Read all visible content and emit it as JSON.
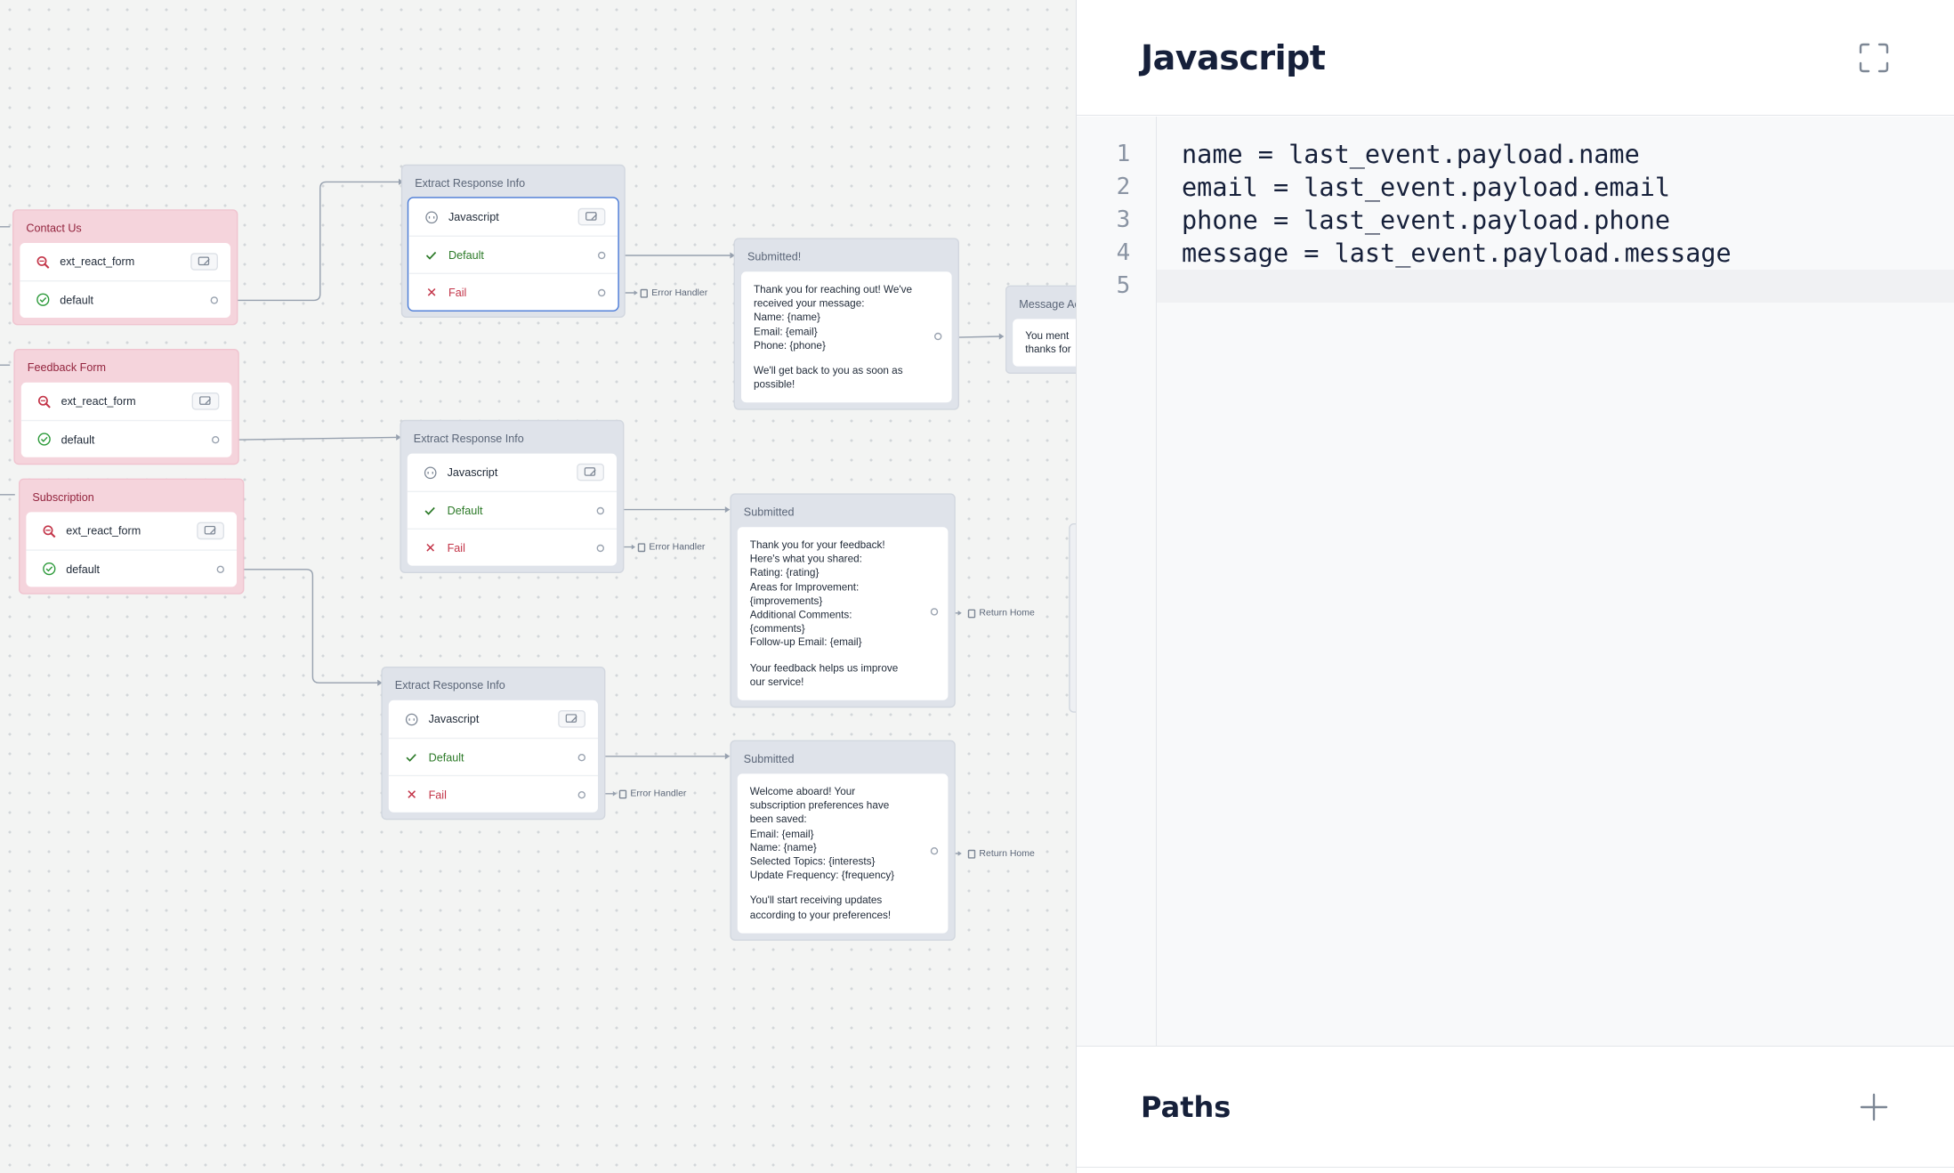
{
  "canvas": {
    "flows": [
      {
        "trigger_title": "Contact Us",
        "trigger_source": "ext_react_form",
        "trigger_default": "default",
        "extract_title": "Extract Response Info",
        "step_label": "Javascript",
        "default_label": "Default",
        "fail_label": "Fail",
        "error_tag": "Error Handler",
        "submitted_title": "Submitted!",
        "message_paragraphs": [
          "Thank you for reaching out! We've\nreceived your message:\nName: {name}\nEmail: {email}\nPhone: {phone}",
          "We'll get back to you as soon as\npossible!"
        ]
      },
      {
        "trigger_title": "Feedback Form",
        "trigger_source": "ext_react_form",
        "trigger_default": "default",
        "extract_title": "Extract Response Info",
        "step_label": "Javascript",
        "default_label": "Default",
        "fail_label": "Fail",
        "error_tag": "Error Handler",
        "submitted_title": "Submitted",
        "message_paragraphs": [
          "Thank you for your feedback!\nHere's what you shared:\nRating: {rating}\nAreas for Improvement:\n{improvements}\nAdditional Comments:\n{comments}\nFollow-up Email: {email}",
          "Your feedback helps us improve\nour service!"
        ],
        "next_tag": "Return Home"
      },
      {
        "trigger_title": "Subscription",
        "trigger_source": "ext_react_form",
        "trigger_default": "default",
        "extract_title": "Extract Response Info",
        "step_label": "Javascript",
        "default_label": "Default",
        "fail_label": "Fail",
        "error_tag": "Error Handler",
        "submitted_title": "Submitted",
        "message_paragraphs": [
          "Welcome aboard! Your\nsubscription preferences have\nbeen saved:\nEmail: {email}\nName: {name}\nSelected Topics: {interests}\nUpdate Frequency: {frequency}",
          "You'll start receiving updates\naccording to your preferences!"
        ],
        "next_tag": "Return Home"
      }
    ],
    "partial_block": {
      "title": "Message Ac",
      "text": "You ment\nthanks for"
    }
  },
  "panel": {
    "title": "Javascript",
    "code_lines": [
      "name = last_event.payload.name",
      "email = last_event.payload.email",
      "phone = last_event.payload.phone",
      "message = last_event.payload.message",
      ""
    ],
    "line_numbers": [
      "1",
      "2",
      "3",
      "4",
      "5"
    ],
    "paths_title": "Paths"
  },
  "icons": {
    "expand": "expand-icon",
    "add": "plus-icon",
    "trigger": "react-form-icon",
    "step": "javascript-step-icon",
    "default": "check-icon",
    "fail": "x-icon",
    "edit": "edit-icon",
    "link": "document-link-icon"
  },
  "colors": {
    "trigger_block": "#f5d4dc",
    "trigger_title": "#93243e",
    "step_block": "#dfe3ea",
    "selected": "#4a7bd8",
    "default_green": "#2c7a28",
    "fail_red": "#c33448"
  }
}
